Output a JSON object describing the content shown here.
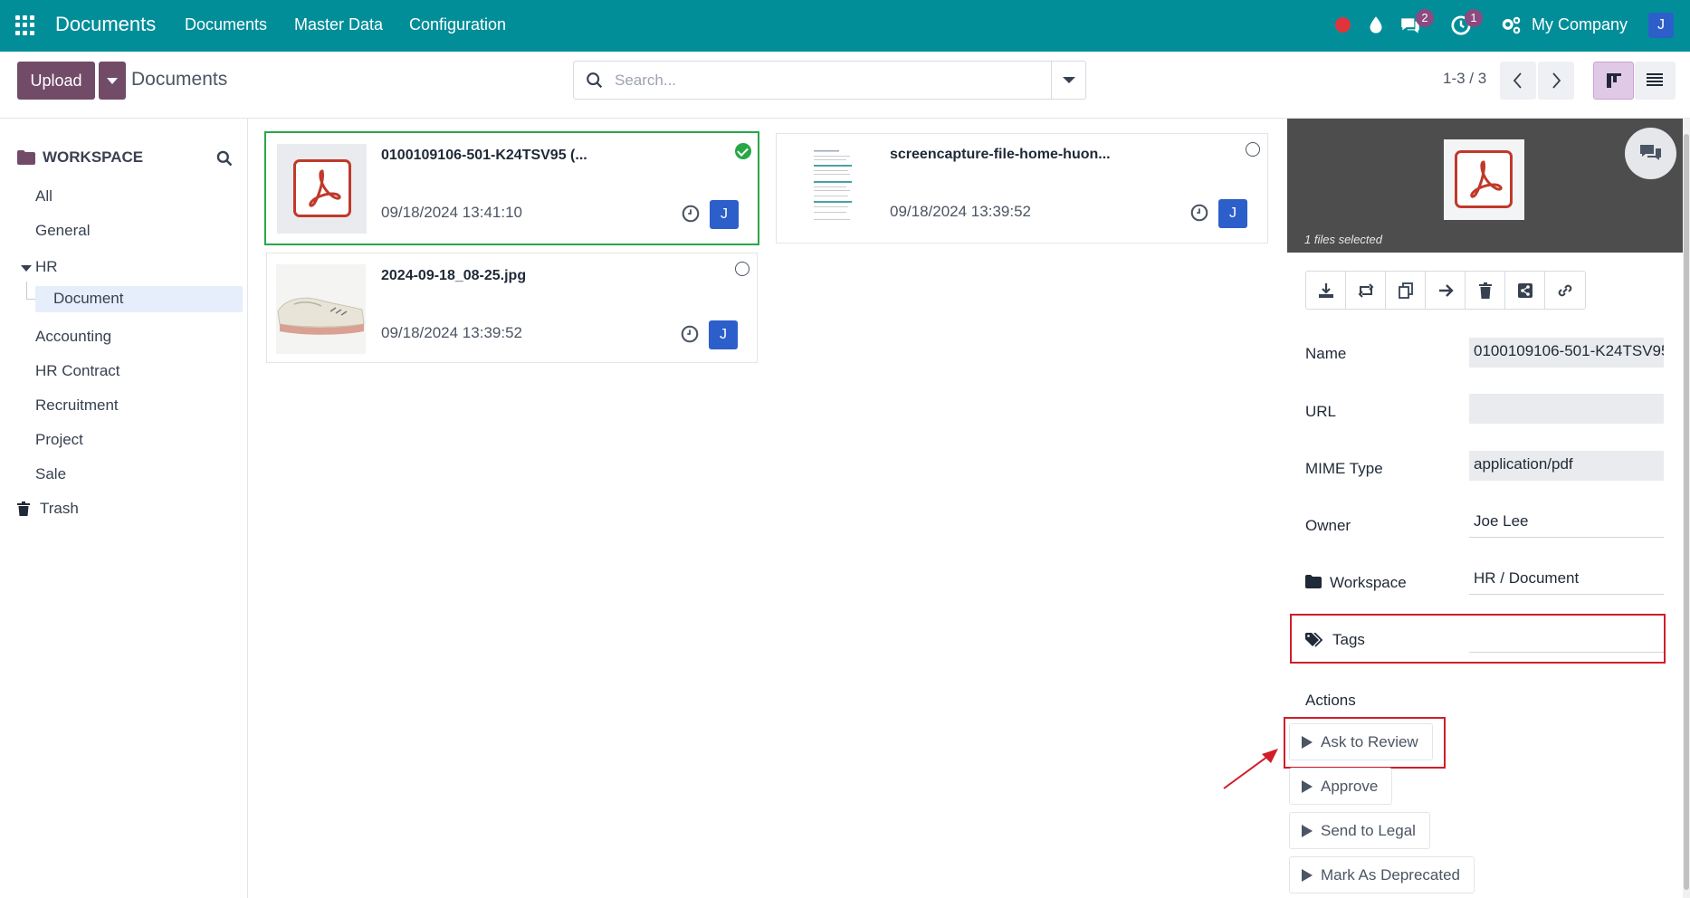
{
  "navbar": {
    "app_name": "Documents",
    "menu": [
      "Documents",
      "Master Data",
      "Configuration"
    ],
    "messages_badge": "2",
    "activities_badge": "1",
    "company": "My Company",
    "avatar_initial": "J"
  },
  "control_panel": {
    "upload_label": "Upload",
    "breadcrumb": "Documents",
    "search_placeholder": "Search...",
    "pager": "1-3 / 3"
  },
  "sidebar": {
    "title": "WORKSPACE",
    "items": [
      "All",
      "General",
      "HR",
      "Document",
      "Accounting",
      "HR Contract",
      "Recruitment",
      "Project",
      "Sale",
      "Trash"
    ],
    "active": "Document"
  },
  "documents": [
    {
      "name": "0100109106-501-K24TSV95 (...",
      "date": "09/18/2024 13:41:10",
      "owner_initial": "J",
      "thumbnail": "pdf-icon",
      "selected": true
    },
    {
      "name": "screencapture-file-home-huon...",
      "date": "09/18/2024 13:39:52",
      "owner_initial": "J",
      "thumbnail": "screenshot-thumbnail",
      "selected": false
    },
    {
      "name": "2024-09-18_08-25.jpg",
      "date": "09/18/2024 13:39:52",
      "owner_initial": "J",
      "thumbnail": "shoe-image",
      "selected": false
    }
  ],
  "panel": {
    "files_selected": "1 files selected",
    "fields": {
      "name_label": "Name",
      "name_value": "0100109106-501-K24TSV95",
      "url_label": "URL",
      "url_value": "",
      "mime_label": "MIME Type",
      "mime_value": "application/pdf",
      "owner_label": "Owner",
      "owner_value": "Joe Lee",
      "workspace_label": "Workspace",
      "workspace_value": "HR / Document",
      "tags_label": "Tags",
      "tags_value": ""
    },
    "actions_title": "Actions",
    "actions": [
      "Ask to Review",
      "Approve",
      "Send to Legal",
      "Mark As Deprecated"
    ]
  },
  "colors": {
    "navbar": "#018e99",
    "primary": "#714b67",
    "selected_border": "#28a745",
    "highlight": "#d01d2a",
    "avatar": "#2c5fca"
  }
}
